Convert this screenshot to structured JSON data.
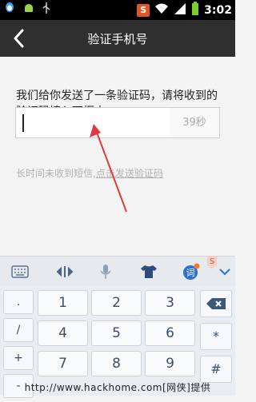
{
  "status": {
    "time": "3:02",
    "s_label": "S"
  },
  "header": {
    "title": "验证手机号"
  },
  "content": {
    "message": "我们给你发送了一条验证码，请将收到的验证码填入下框中",
    "code_value": "",
    "timer": "39秒",
    "hint_text": "长时间未收到短信,",
    "hint_link": "点击发送验证码"
  },
  "keyboard": {
    "side_keys": [
      ".",
      "/",
      "+",
      "-"
    ],
    "keys": [
      "1",
      "2",
      "3",
      "4",
      "5",
      "6",
      "7",
      "8",
      "9"
    ],
    "right_keys": [
      "*",
      "#"
    ],
    "ime_word_label": "词"
  },
  "watermark": "http://www.hackhome.com[网侠]提供"
}
